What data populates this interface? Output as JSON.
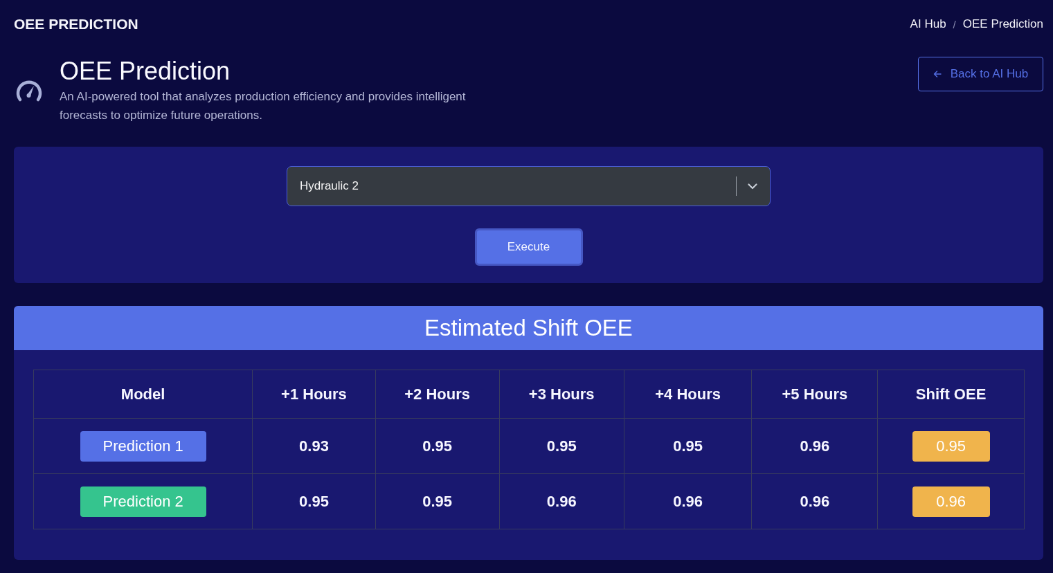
{
  "top_bar": {
    "title": "OEE PREDICTION",
    "breadcrumb": [
      "AI Hub",
      "OEE Prediction"
    ],
    "breadcrumb_separator": "/"
  },
  "intro": {
    "title": "OEE Prediction",
    "description": "An AI-powered tool that analyzes production efficiency and provides intelligent forecasts to optimize future operations.",
    "back_button": "Back to AI Hub"
  },
  "controls": {
    "machine_select": {
      "value": "Hydraulic 2"
    },
    "execute_button": "Execute"
  },
  "results": {
    "title": "Estimated Shift OEE",
    "columns": [
      "Model",
      "+1 Hours",
      "+2 Hours",
      "+3 Hours",
      "+4 Hours",
      "+5 Hours",
      "Shift OEE"
    ],
    "rows": [
      {
        "model": "Prediction 1",
        "color": "#5570e6",
        "values": [
          "0.93",
          "0.95",
          "0.95",
          "0.95",
          "0.96"
        ],
        "shift_oee": "0.95"
      },
      {
        "model": "Prediction 2",
        "color": "#35c48e",
        "values": [
          "0.95",
          "0.95",
          "0.96",
          "0.96",
          "0.96"
        ],
        "shift_oee": "0.96"
      }
    ]
  }
}
